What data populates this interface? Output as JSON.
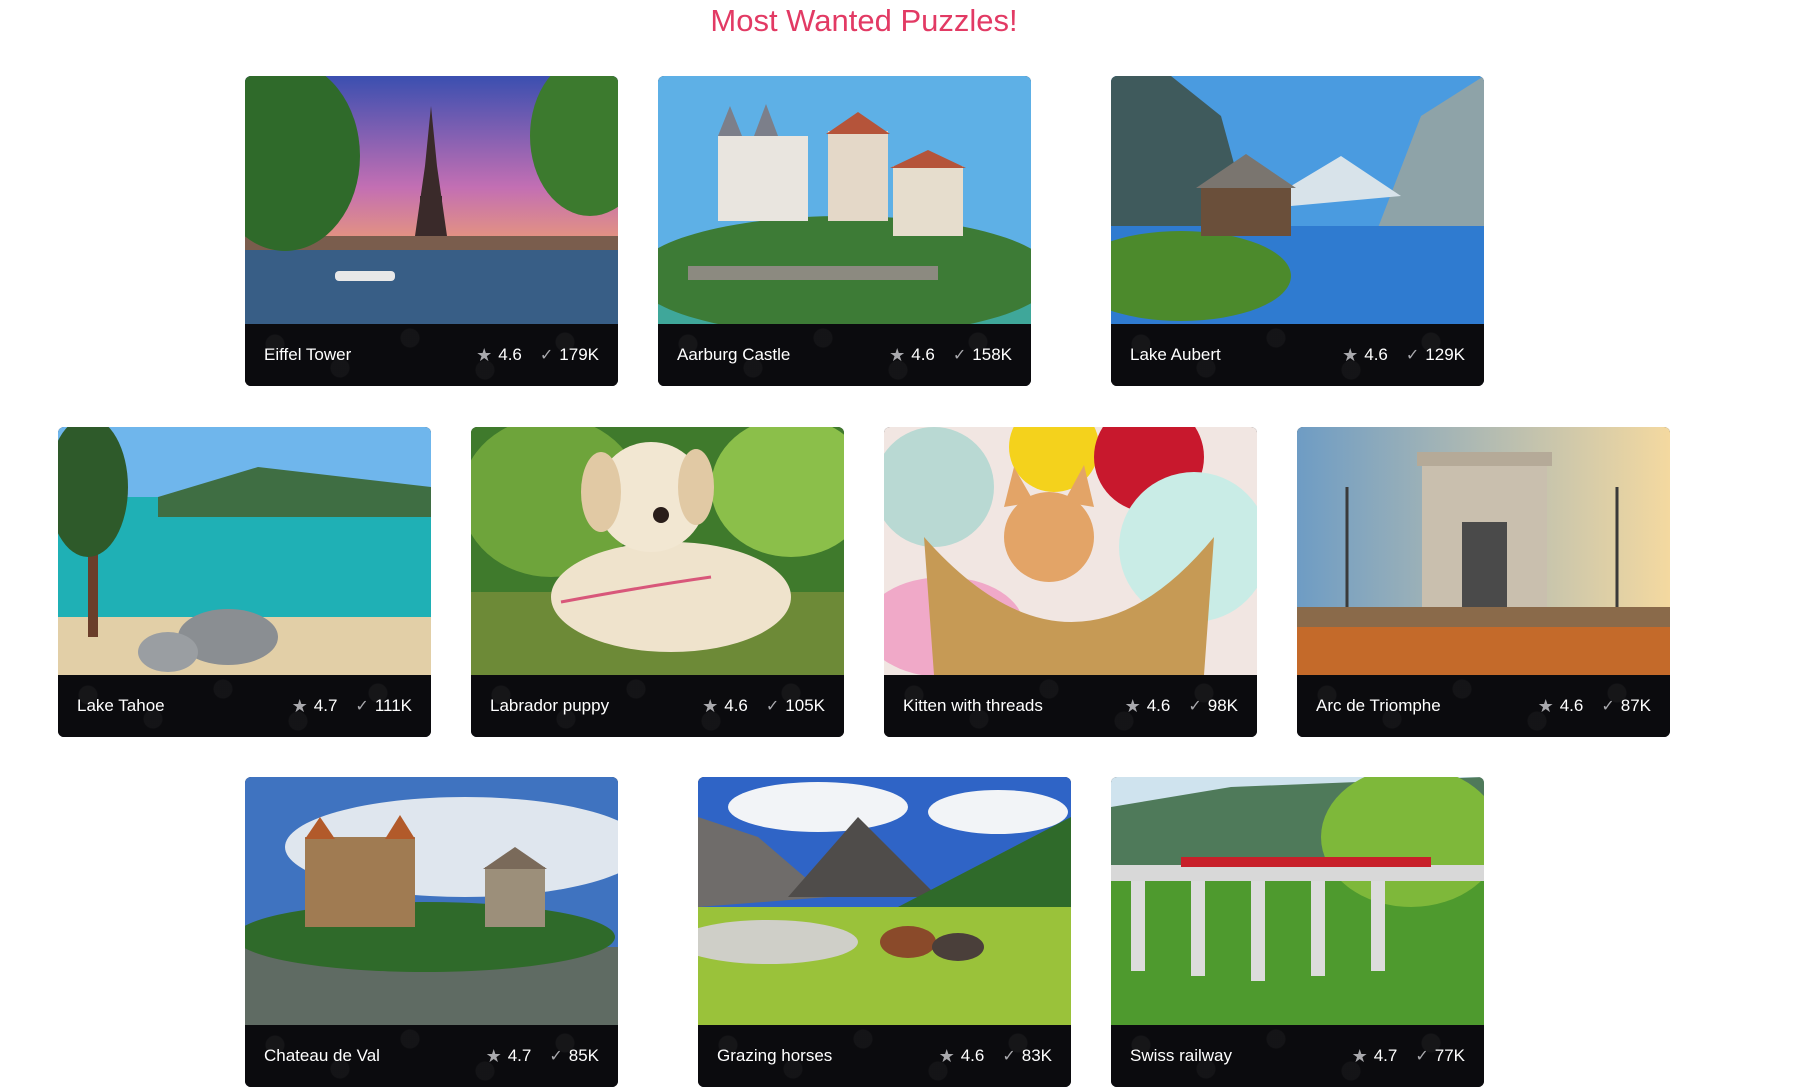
{
  "header": {
    "title": "Most Wanted Puzzles!"
  },
  "icons": {
    "rating": "star-icon",
    "plays": "checkmark-icon"
  },
  "colors": {
    "title": "#e23a64",
    "caption_bg": "#0b0b0e"
  },
  "puzzles": [
    {
      "name": "Eiffel Tower",
      "rating": "4.6",
      "plays": "179K",
      "image": "eiffel-tower-photo"
    },
    {
      "name": "Aarburg Castle",
      "rating": "4.6",
      "plays": "158K",
      "image": "aarburg-castle-photo"
    },
    {
      "name": "Lake Aubert",
      "rating": "4.6",
      "plays": "129K",
      "image": "lake-aubert-photo"
    },
    {
      "name": "Lake Tahoe",
      "rating": "4.7",
      "plays": "111K",
      "image": "lake-tahoe-photo"
    },
    {
      "name": "Labrador puppy",
      "rating": "4.6",
      "plays": "105K",
      "image": "labrador-puppy-photo"
    },
    {
      "name": "Kitten with threads",
      "rating": "4.6",
      "plays": "98K",
      "image": "kitten-with-threads-photo"
    },
    {
      "name": "Arc de Triomphe",
      "rating": "4.6",
      "plays": "87K",
      "image": "arc-de-triomphe-photo"
    },
    {
      "name": "Chateau de Val",
      "rating": "4.7",
      "plays": "85K",
      "image": "chateau-de-val-photo"
    },
    {
      "name": "Grazing horses",
      "rating": "4.6",
      "plays": "83K",
      "image": "grazing-horses-photo"
    },
    {
      "name": "Swiss railway",
      "rating": "4.7",
      "plays": "77K",
      "image": "swiss-railway-photo"
    }
  ]
}
